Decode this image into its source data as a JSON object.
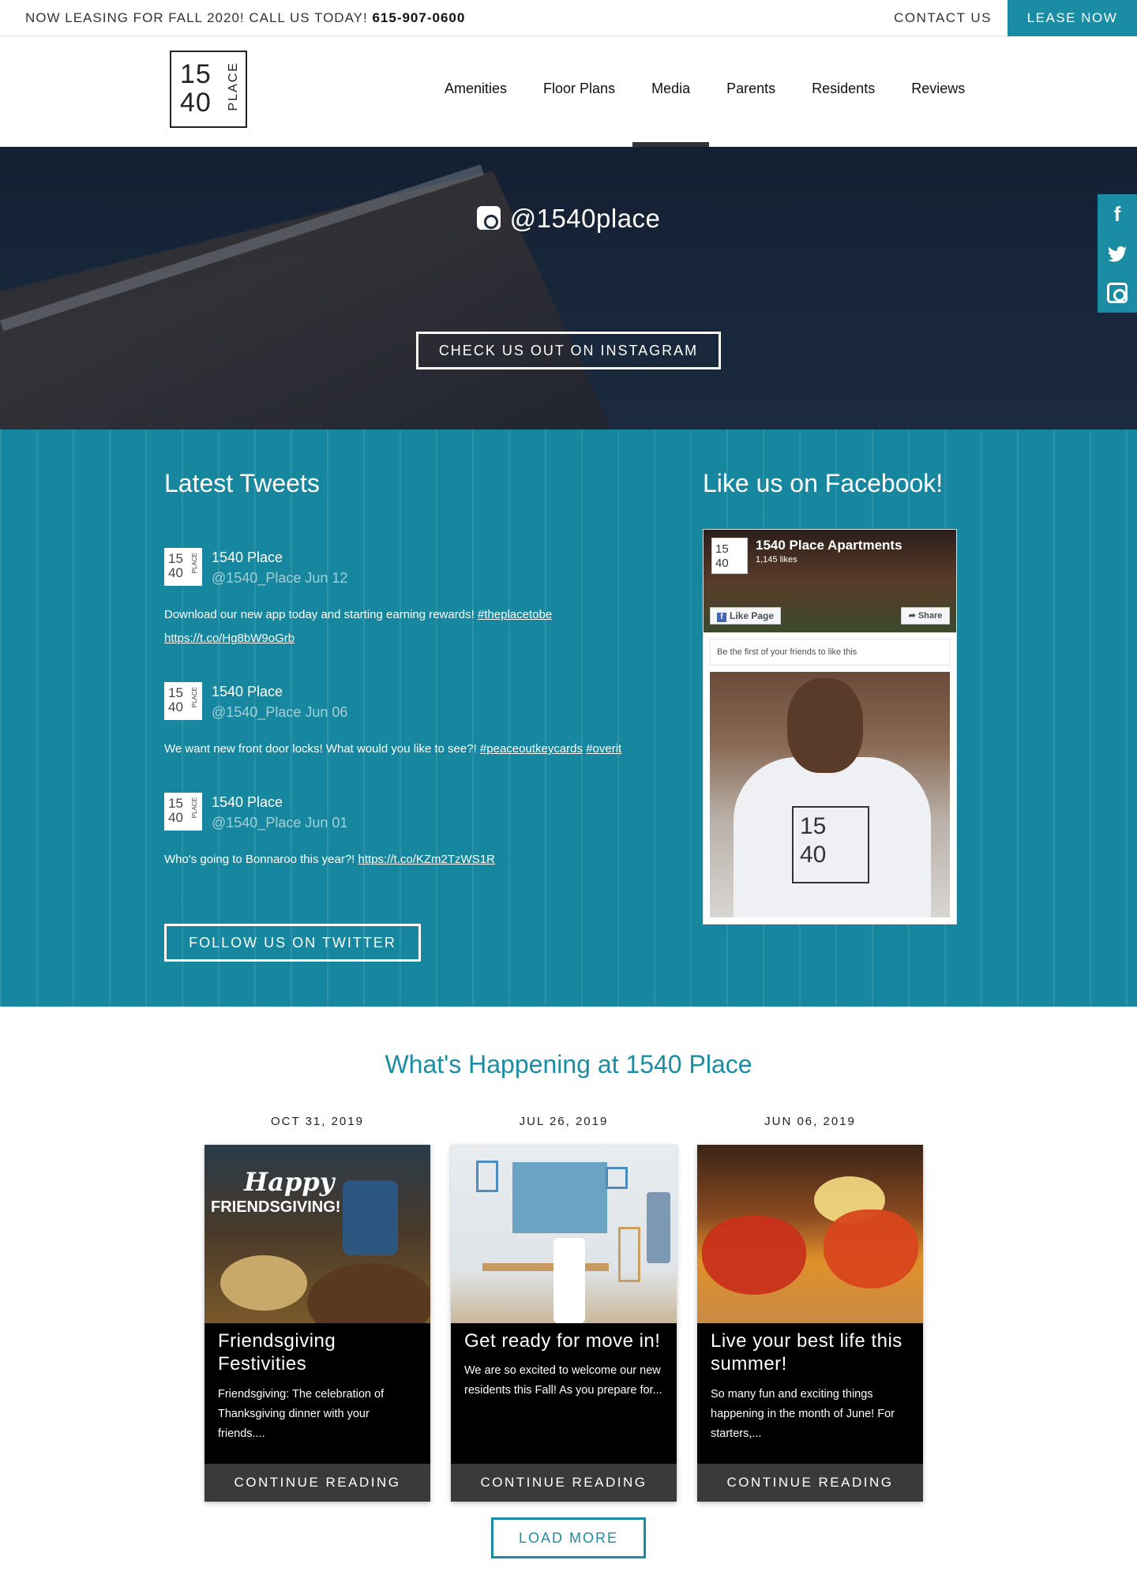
{
  "topbar": {
    "leasing_text": "NOW LEASING FOR FALL 2020! CALL US TODAY!",
    "phone": "615-907-0600",
    "contact_label": "CONTACT US",
    "lease_now_label": "LEASE NOW",
    "accent_color": "#1a8da5"
  },
  "logo": {
    "line1": "15",
    "line2": "40",
    "word": "PLACE"
  },
  "nav": {
    "items": [
      {
        "label": "Amenities"
      },
      {
        "label": "Floor Plans"
      },
      {
        "label": "Media",
        "active": true
      },
      {
        "label": "Parents"
      },
      {
        "label": "Residents"
      },
      {
        "label": "Reviews"
      }
    ]
  },
  "hero": {
    "instagram_handle": "@1540place",
    "instagram_button": "CHECK US OUT ON INSTAGRAM"
  },
  "social_side": {
    "facebook_glyph": "f",
    "twitter_glyph": "🐦",
    "icons": [
      "facebook-icon",
      "twitter-icon",
      "instagram-icon"
    ]
  },
  "tweets": {
    "title": "Latest Tweets",
    "items": [
      {
        "name": "1540 Place",
        "meta": "@1540_Place Jun 12",
        "text": "Download our new app today and starting earning rewards!",
        "links": [
          "#theplacetobe",
          "https://t.co/Hg8bW9oGrb"
        ]
      },
      {
        "name": "1540 Place",
        "meta": "@1540_Place Jun 06",
        "text": "We want new front door locks! What would you like to see?!",
        "links": [
          "#peaceoutkeycards",
          "#overit"
        ]
      },
      {
        "name": "1540 Place",
        "meta": "@1540_Place Jun 01",
        "text": "Who's going to Bonnaroo this year?!",
        "links": [
          "https://t.co/KZm2TzWS1R"
        ]
      }
    ],
    "follow_button": "FOLLOW US ON TWITTER"
  },
  "facebook": {
    "title": "Like us on Facebook!",
    "page_name": "1540 Place Apartments",
    "likes": "1,145 likes",
    "like_page": "Like Page",
    "share": "Share",
    "first_friends": "Be the first of your friends to like this"
  },
  "news": {
    "title": "What's Happening at 1540 Place",
    "posts": [
      {
        "date": "OCT 31, 2019",
        "title": "Friendsgiving Festivities",
        "excerpt": "Friendsgiving: The celebration of Thanksgiving dinner with your friends....",
        "cta": "CONTINUE READING",
        "img_text1": "Happy",
        "img_text2": "FRIENDSGIVING!"
      },
      {
        "date": "JUL 26, 2019",
        "title": "Get ready for move in!",
        "excerpt": "We are so excited to welcome our new residents this Fall! As you prepare for...",
        "cta": "CONTINUE READING"
      },
      {
        "date": "JUN 06, 2019",
        "title": "Live your best life this summer!",
        "excerpt": "So many fun and exciting things happening in the month of June! For starters,...",
        "cta": "CONTINUE READING"
      }
    ],
    "load_more": "LOAD MORE"
  }
}
